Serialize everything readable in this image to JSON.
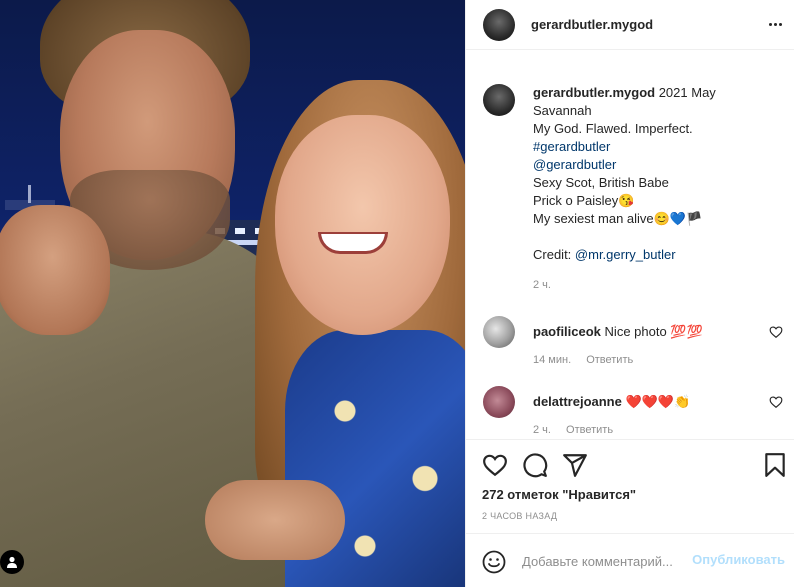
{
  "post": {
    "username": "gerardbutler.mygod",
    "caption_lines": [
      "2021 May",
      "Savannah",
      "My God. Flawed. Imperfect.",
      "#gerardbutler",
      "@gerardbutler",
      "Sexy Scot, British Babe",
      "Prick o Paisley😘",
      "My sexiest man alive😊💙🏴",
      "",
      "Credit:",
      "@mr.gerry_butler"
    ],
    "caption_time": "2 ч."
  },
  "comments": [
    {
      "username": "paofiliceok",
      "text": "Nice photo 💯💯",
      "time": "14 мин.",
      "reply": "Ответить"
    },
    {
      "username": "delattrejoanne",
      "text": "❤️❤️❤️👏",
      "time": "2 ч.",
      "reply": "Ответить"
    }
  ],
  "likes_text": "272 отметок \"Нравится\"",
  "post_time": "2 ЧАСОВ НАЗАД",
  "comment_box": {
    "placeholder": "Добавьте комментарий...",
    "publish_label": "Опубликовать"
  },
  "icons": {
    "more": "more-horizontal-icon",
    "like": "heart-icon",
    "comment": "comment-icon",
    "share": "paper-plane-icon",
    "save": "bookmark-icon",
    "emoji": "smiley-icon",
    "tag": "user-tag-icon"
  },
  "colors": {
    "link": "#00376b",
    "muted": "#8e8e8e",
    "publish_disabled": "#b2dffc",
    "border": "#efefef"
  }
}
